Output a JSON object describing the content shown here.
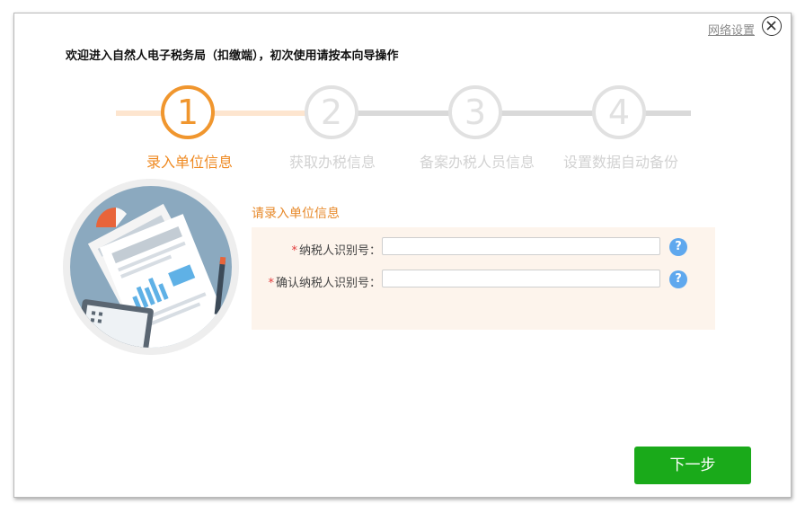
{
  "header": {
    "welcome_text": "欢迎进入自然人电子税务局（扣缴端），初次使用请按本向导操作",
    "network_settings": "网络设置"
  },
  "steps": [
    {
      "number": "1",
      "label": "录入单位信息",
      "state": "active"
    },
    {
      "number": "2",
      "label": "获取办税信息",
      "state": "inactive"
    },
    {
      "number": "3",
      "label": "备案办税人员信息",
      "state": "inactive"
    },
    {
      "number": "4",
      "label": "设置数据自动备份",
      "state": "inactive"
    }
  ],
  "form": {
    "section_title": "请录入单位信息",
    "fields": [
      {
        "required_mark": "*",
        "label": "纳税人识别号：",
        "value": "",
        "help": "?"
      },
      {
        "required_mark": "*",
        "label": "确认纳税人识别号：",
        "value": "",
        "help": "?"
      }
    ]
  },
  "footer": {
    "next_label": "下一步"
  },
  "colors": {
    "accent_orange": "#f0962e",
    "inactive_gray": "#e1e1e1",
    "next_green": "#1aaa1a",
    "help_blue": "#5fa8ee",
    "panel_bg": "#fdf4ec"
  },
  "icons": [
    "close-icon",
    "help-icon",
    "document-illustration"
  ]
}
